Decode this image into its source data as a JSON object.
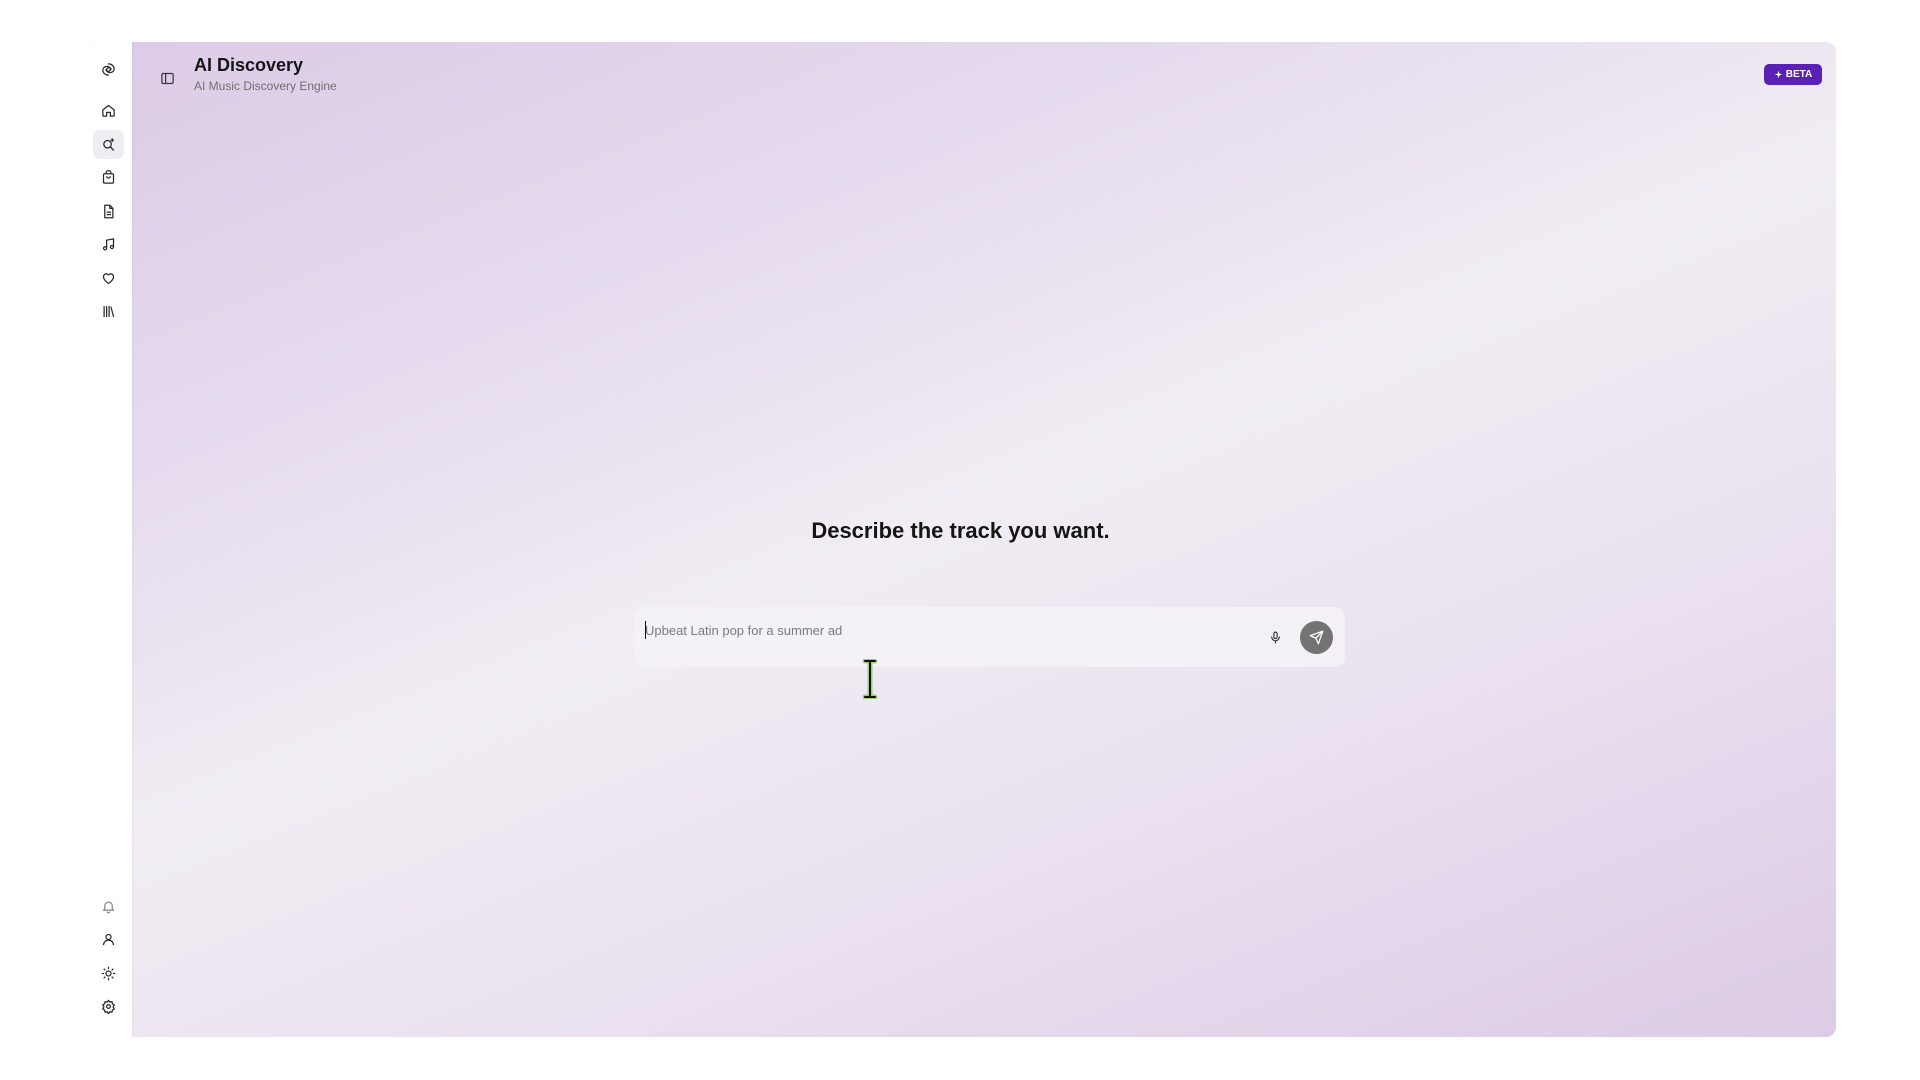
{
  "header": {
    "title": "AI Discovery",
    "subtitle": "AI Music Discovery Engine",
    "badge": "BETA",
    "sidebar_toggle_icon": "sidebar-panel-icon"
  },
  "sidebar": {
    "logo_icon": "spiral-logo-icon",
    "nav_items": [
      {
        "icon": "home-icon",
        "active": false
      },
      {
        "icon": "search-sparkle-icon",
        "active": true
      },
      {
        "icon": "shopping-bag-icon",
        "active": false
      },
      {
        "icon": "document-icon",
        "active": false
      },
      {
        "icon": "music-note-icon",
        "active": false
      },
      {
        "icon": "heart-icon",
        "active": false
      },
      {
        "icon": "library-icon",
        "active": false
      }
    ],
    "bottom_items": [
      {
        "icon": "bell-icon"
      },
      {
        "icon": "user-icon"
      },
      {
        "icon": "sun-icon"
      },
      {
        "icon": "settings-gear-icon"
      }
    ]
  },
  "main": {
    "heading": "Describe the track you want.",
    "prompt": {
      "value": "",
      "placeholder": "Upbeat Latin pop for a summer ad",
      "mic_icon": "microphone-icon",
      "send_icon": "send-arrow-icon"
    }
  },
  "colors": {
    "accent": "#5b21b6",
    "send_button": "#737373",
    "background_gradient": [
      "#dccbe7",
      "#f1edf3",
      "#dccbe6"
    ]
  }
}
